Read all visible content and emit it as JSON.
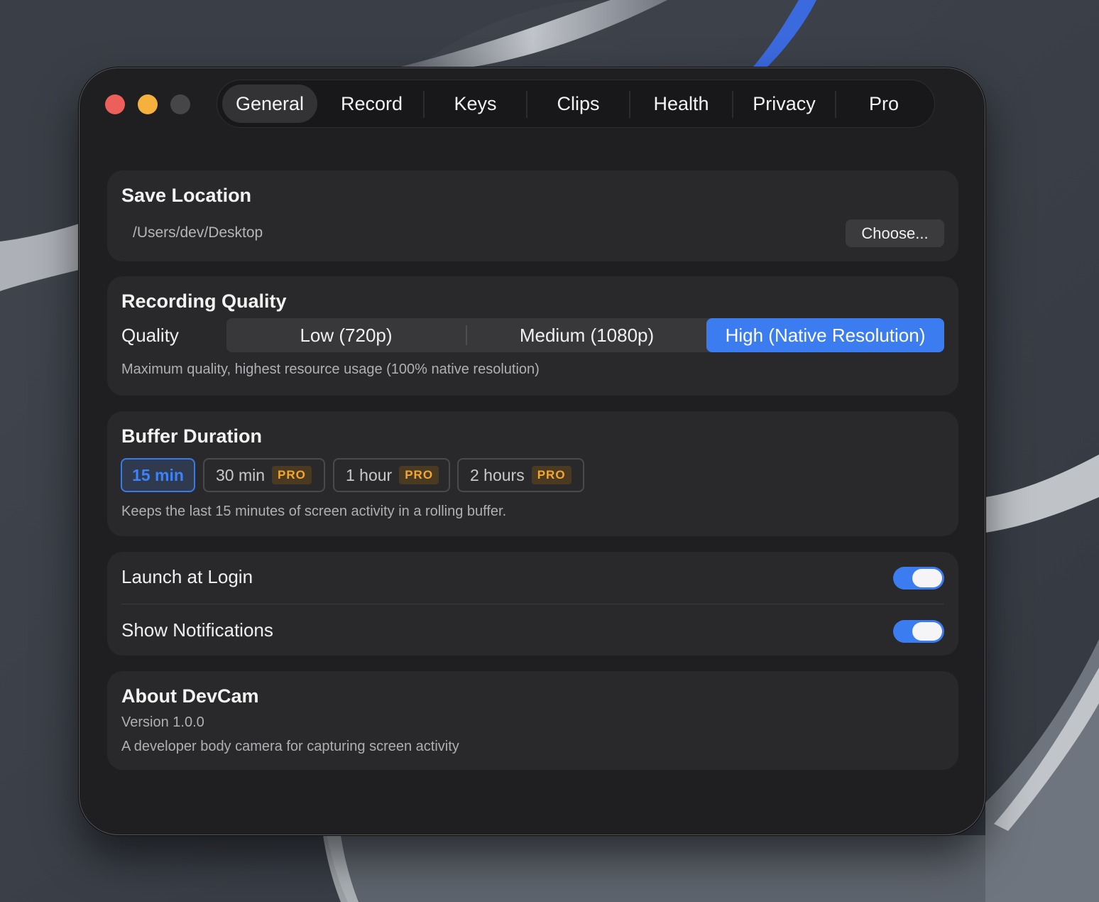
{
  "window": {
    "traffic_lights": [
      "close",
      "minimize",
      "zoom"
    ]
  },
  "tabs": [
    {
      "label": "General",
      "active": true
    },
    {
      "label": "Record",
      "active": false
    },
    {
      "label": "Keys",
      "active": false
    },
    {
      "label": "Clips",
      "active": false
    },
    {
      "label": "Health",
      "active": false
    },
    {
      "label": "Privacy",
      "active": false
    },
    {
      "label": "Pro",
      "active": false
    }
  ],
  "save_location": {
    "title": "Save Location",
    "path": "/Users/dev/Desktop",
    "choose_label": "Choose..."
  },
  "recording_quality": {
    "title": "Recording Quality",
    "label": "Quality",
    "options": [
      "Low (720p)",
      "Medium (1080p)",
      "High (Native Resolution)"
    ],
    "selected": "High (Native Resolution)",
    "description": "Maximum quality, highest resource usage (100% native resolution)"
  },
  "buffer_duration": {
    "title": "Buffer Duration",
    "options": [
      {
        "label": "15 min",
        "pro": false,
        "selected": true
      },
      {
        "label": "30 min",
        "pro": true,
        "selected": false
      },
      {
        "label": "1 hour",
        "pro": true,
        "selected": false
      },
      {
        "label": "2 hours",
        "pro": true,
        "selected": false
      }
    ],
    "pro_badge": "PRO",
    "description": "Keeps the last 15 minutes of screen activity in a rolling buffer."
  },
  "toggles": [
    {
      "label": "Launch at Login",
      "on": true
    },
    {
      "label": "Show Notifications",
      "on": true
    }
  ],
  "about": {
    "title": "About DevCam",
    "version": "Version 1.0.0",
    "description": "A developer body camera for capturing screen activity"
  },
  "colors": {
    "accent": "#3b7df1",
    "pro_badge_text": "#f3a733",
    "window_bg": "#1f1f21",
    "card_bg": "#29292b"
  }
}
